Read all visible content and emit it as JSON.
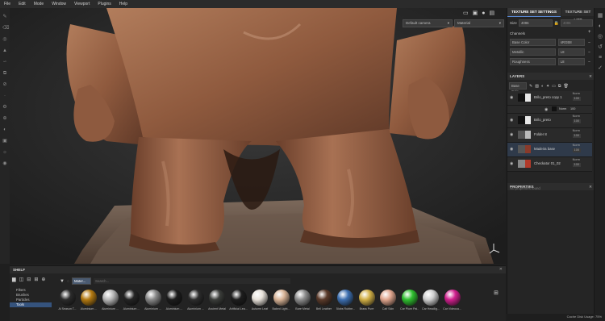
{
  "menubar": {
    "items": [
      "File",
      "Edit",
      "Mode",
      "Window",
      "Viewport",
      "Plugins",
      "Help"
    ]
  },
  "viewport": {
    "camera_select": "Default camera",
    "display_select": "Material"
  },
  "texture_set_settings": {
    "tab_label": "TEXTURE SET SETTINGS",
    "list_tab_label": "TEXTURE SET LIST",
    "size_label": "Size",
    "size_value": "4096",
    "size_linked_value": "4096",
    "channels_label": "Channels",
    "channels": [
      {
        "name": "Base Color",
        "format": "sRGB8"
      },
      {
        "name": "Metallic",
        "format": "L8"
      },
      {
        "name": "Roughness",
        "format": "L8"
      }
    ]
  },
  "layers": {
    "header": "LAYERS",
    "channel_select": "Base Colo",
    "items": [
      {
        "name": "Brilo_preto copy 1",
        "blend": "Norm",
        "opacity": "100",
        "selected": false
      },
      {
        "name": "Brilo_preto",
        "blend": "Norm",
        "opacity": "100",
        "selected": false
      },
      {
        "name": "Folder 8",
        "blend": "Norm",
        "opacity": "100",
        "selected": false
      },
      {
        "name": "Madeira base",
        "blend": "Norm",
        "opacity": "100",
        "selected": true
      },
      {
        "name": "Checkator 01_02",
        "blend": "Norm",
        "opacity": "100",
        "selected": false
      }
    ],
    "subrow_blend": "Norm",
    "subrow_opacity": "100"
  },
  "properties": {
    "header": "PROPERTIES",
    "empty_text": "No properties found"
  },
  "shelf": {
    "header": "SHELF",
    "filter_chip": "Mater...",
    "search_placeholder": "Search...",
    "categories": [
      "Filters",
      "Brushes",
      "Particles",
      "Tools"
    ],
    "selected_category": "Tools",
    "materials": [
      {
        "label": "Al Season T...",
        "color": "#2b2b2b"
      },
      {
        "label": "Aluminium ...",
        "color": "#b37a12"
      },
      {
        "label": "Aluminium ...",
        "color": "#b8b8b8"
      },
      {
        "label": "Aluminium ...",
        "color": "#242424"
      },
      {
        "label": "Aluminium ...",
        "color": "#888888"
      },
      {
        "label": "Aluminium ...",
        "color": "#1c1c1c"
      },
      {
        "label": "Aluminium ...",
        "color": "#2c2c2c"
      },
      {
        "label": "Ancient Metal",
        "color": "#3b3d3a"
      },
      {
        "label": "Artificial Lea...",
        "color": "#1d1d1d"
      },
      {
        "label": "Autumn Leaf",
        "color": "#e8e2da"
      },
      {
        "label": "Baked Light...",
        "color": "#d9b497"
      },
      {
        "label": "Bare Metal",
        "color": "#8d8d8d"
      },
      {
        "label": "Bell Leather",
        "color": "#5a3a2a"
      },
      {
        "label": "Blobs Rubbe...",
        "color": "#3d6fb0"
      },
      {
        "label": "Brass Pure",
        "color": "#d2b046"
      },
      {
        "label": "Calf Skin",
        "color": "#e1a68e"
      },
      {
        "label": "Car Plum Pai...",
        "color": "#2fbf2f"
      },
      {
        "label": "Car Headlig...",
        "color": "#cfcfcf"
      },
      {
        "label": "Car Videoca...",
        "color": "#d0208e"
      }
    ]
  },
  "status": {
    "text": "Cache Disk Usage: 75%"
  }
}
